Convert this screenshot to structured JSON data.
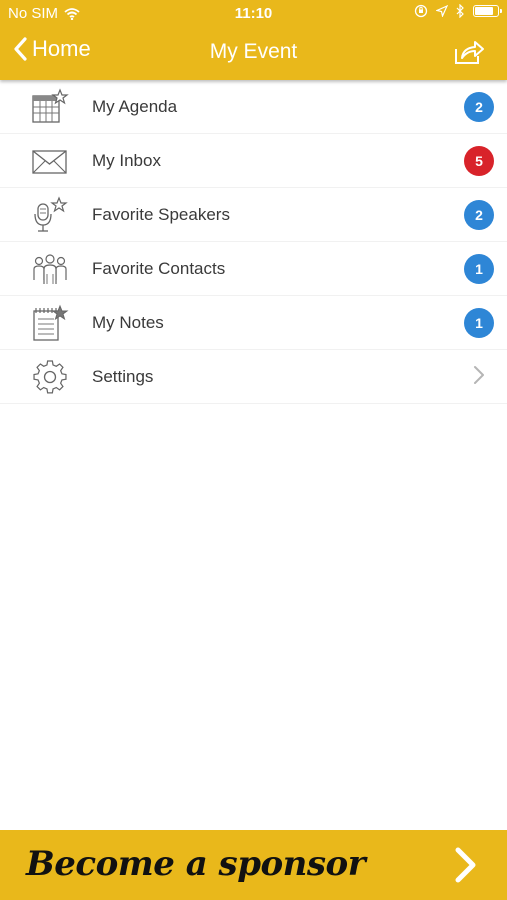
{
  "status_bar": {
    "carrier": "No SIM",
    "time": "11:10",
    "battery_level": 0.85
  },
  "nav": {
    "back_label": "Home",
    "title": "My Event",
    "share_icon": "share-icon"
  },
  "menu": {
    "items": [
      {
        "label": "My Agenda",
        "icon": "calendar-star-icon",
        "badge": "2",
        "badge_color": "#2E86D6"
      },
      {
        "label": "My Inbox",
        "icon": "envelope-icon",
        "badge": "5",
        "badge_color": "#D8232A"
      },
      {
        "label": "Favorite Speakers",
        "icon": "microphone-star-icon",
        "badge": "2",
        "badge_color": "#2E86D6"
      },
      {
        "label": "Favorite Contacts",
        "icon": "people-group-icon",
        "badge": "1",
        "badge_color": "#2E86D6"
      },
      {
        "label": "My Notes",
        "icon": "notepad-star-icon",
        "badge": "1",
        "badge_color": "#2E86D6"
      },
      {
        "label": "Settings",
        "icon": "gear-icon",
        "chevron": "chevron-right-icon"
      }
    ]
  },
  "sponsor_banner": {
    "label": "Become a sponsor",
    "icon": "chevron-right-icon"
  },
  "colors": {
    "brand_yellow": "#E9B81B",
    "badge_blue": "#2E86D6",
    "badge_red": "#D8232A"
  }
}
